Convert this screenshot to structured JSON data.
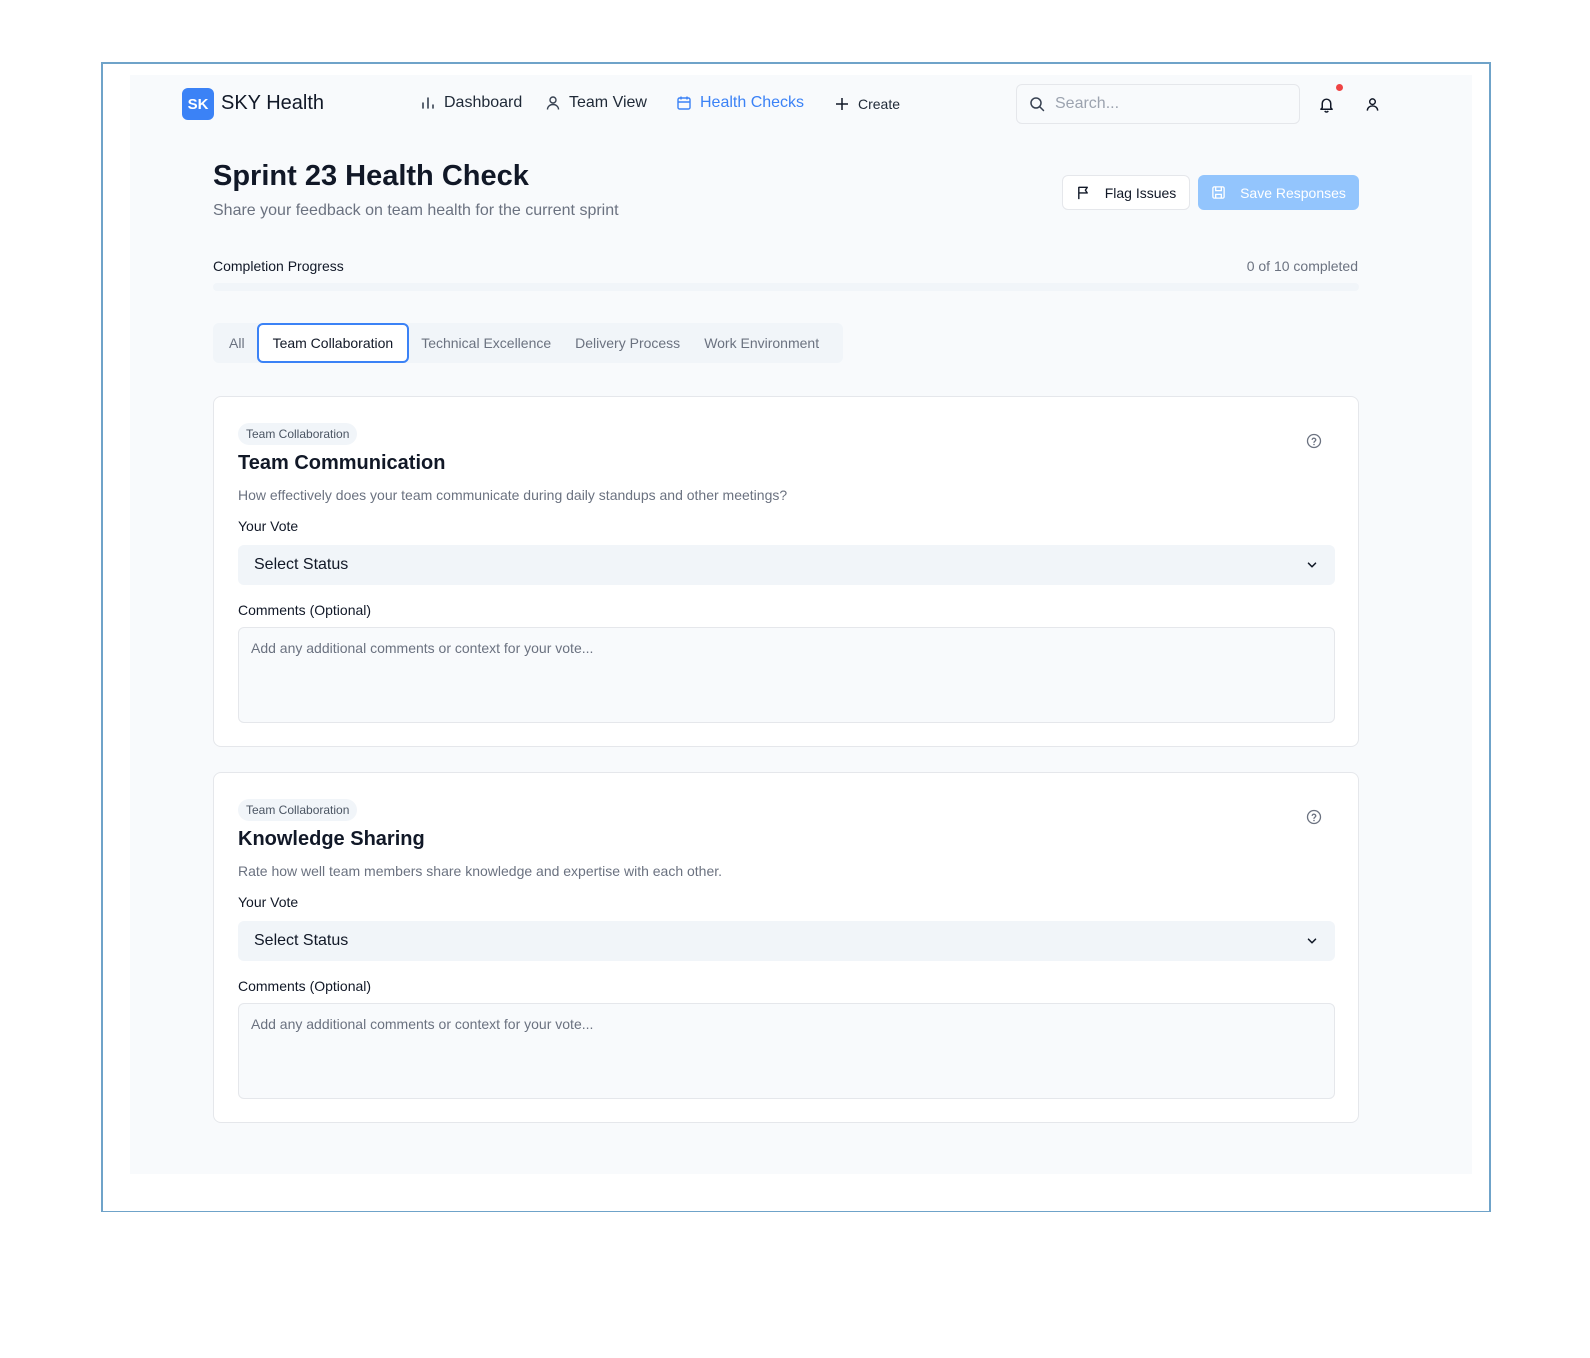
{
  "app": {
    "logo": "SK",
    "name": "SKY Health"
  },
  "nav": {
    "dashboard": "Dashboard",
    "team_view": "Team View",
    "health_checks": "Health Checks",
    "create": "Create"
  },
  "search": {
    "placeholder": "Search..."
  },
  "page": {
    "title": "Sprint 23 Health Check",
    "subtitle": "Share your feedback on team health for the current sprint"
  },
  "actions": {
    "flag": "Flag Issues",
    "save": "Save Responses"
  },
  "progress": {
    "label": "Completion Progress",
    "count_text": "0 of 10 completed",
    "completed": 0,
    "total": 10
  },
  "tabs": [
    {
      "label": "All"
    },
    {
      "label": "Team Collaboration"
    },
    {
      "label": "Technical Excellence"
    },
    {
      "label": "Delivery Process"
    },
    {
      "label": "Work Environment"
    }
  ],
  "cards": [
    {
      "badge": "Team Collaboration",
      "title": "Team Communication",
      "description": "How effectively does your team communicate during daily standups and other meetings?",
      "vote_label": "Your Vote",
      "select_value": "Select Status",
      "comments_label": "Comments (Optional)",
      "comments_placeholder": "Add any additional comments or context for your vote..."
    },
    {
      "badge": "Team Collaboration",
      "title": "Knowledge Sharing",
      "description": "Rate how well team members share knowledge and expertise with each other.",
      "vote_label": "Your Vote",
      "select_value": "Select Status",
      "comments_label": "Comments (Optional)",
      "comments_placeholder": "Add any additional comments or context for your vote..."
    }
  ],
  "colors": {
    "accent": "#3b82f6",
    "save_disabled": "#93c5fd",
    "notification": "#ef4444"
  }
}
